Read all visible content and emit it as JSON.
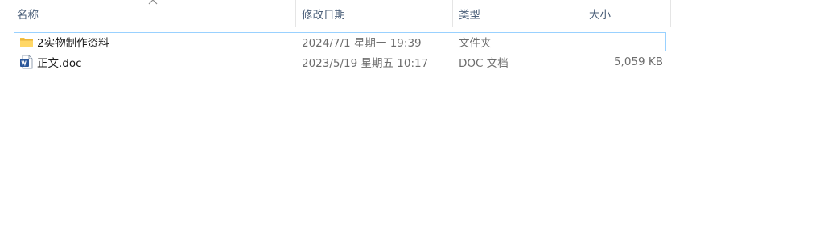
{
  "columns": {
    "name": "名称",
    "modified": "修改日期",
    "type": "类型",
    "size": "大小"
  },
  "files": [
    {
      "name": "2实物制作资料",
      "modified": "2024/7/1 星期一 19:39",
      "type": "文件夹",
      "size": "",
      "icon": "folder-icon"
    },
    {
      "name": "正文.doc",
      "modified": "2023/5/19 星期五 10:17",
      "type": "DOC 文档",
      "size": "5,059 KB",
      "icon": "word-document-icon"
    }
  ],
  "colors": {
    "header_text": "#4c607a",
    "meta_text": "#6d6d6d",
    "focus_border": "#99d1ff",
    "folder": "#f5c244",
    "word": "#2b579a"
  }
}
